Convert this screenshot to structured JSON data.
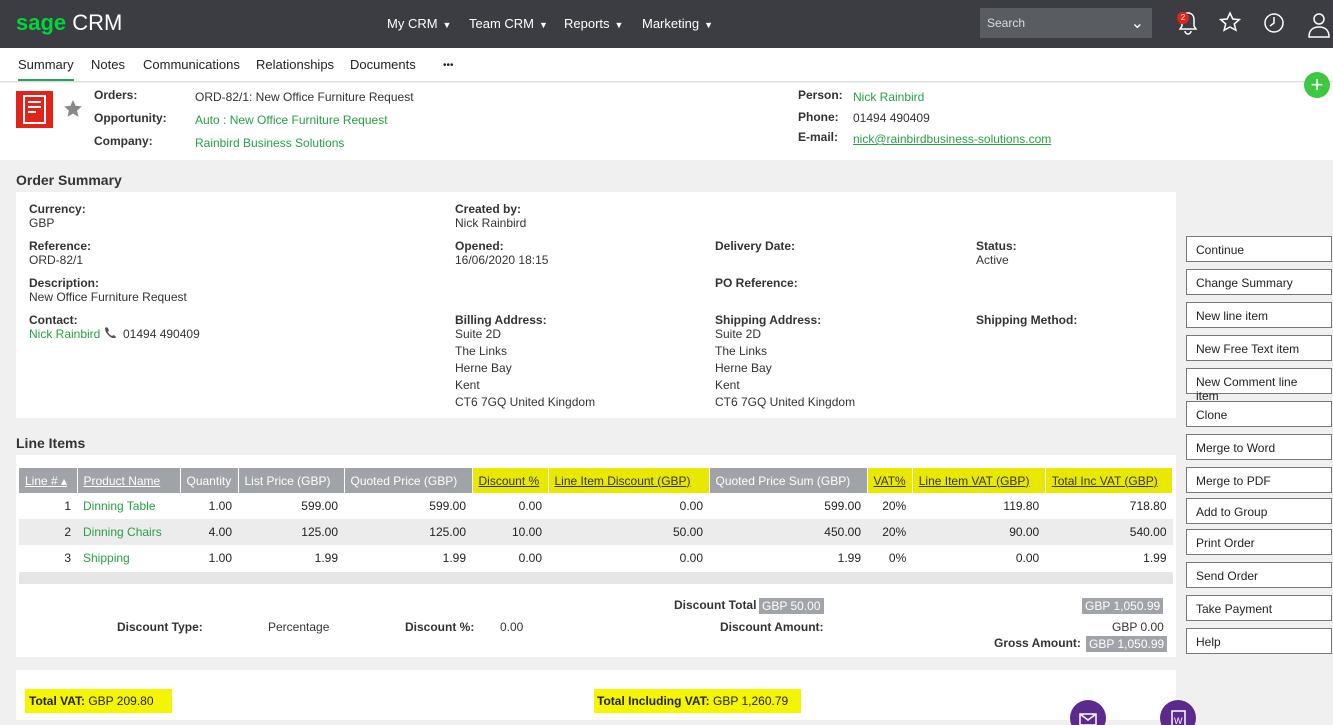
{
  "app": {
    "logo_brand": "sage",
    "logo_product": "CRM",
    "search_placeholder": "Search",
    "notification_count": "2"
  },
  "nav": [
    "My CRM",
    "Team CRM",
    "Reports",
    "Marketing"
  ],
  "tabs": [
    "Summary",
    "Notes",
    "Communications",
    "Relationships",
    "Documents",
    "•••"
  ],
  "header": {
    "orders_label": "Orders:",
    "orders_value": "ORD-82/1: New Office Furniture Request",
    "opportunity_label": "Opportunity:",
    "opportunity_value": "Auto : New Office Furniture Request",
    "company_label": "Company:",
    "company_value": "Rainbird Business Solutions",
    "person_label": "Person:",
    "person_value": "Nick Rainbird",
    "phone_label": "Phone:",
    "phone_value": "01494 490409",
    "email_label": "E-mail:",
    "email_value": "nick@rainbirdbusiness-solutions.com"
  },
  "order_summary": {
    "title": "Order Summary",
    "currency_label": "Currency:",
    "currency": "GBP",
    "created_by_label": "Created by:",
    "created_by": "Nick Rainbird",
    "reference_label": "Reference:",
    "reference": "ORD-82/1",
    "opened_label": "Opened:",
    "opened": "16/06/2020 18:15",
    "delivery_label": "Delivery Date:",
    "status_label": "Status:",
    "status": "Active",
    "description_label": "Description:",
    "description": "New Office Furniture Request",
    "po_label": "PO Reference:",
    "contact_label": "Contact:",
    "contact_name": "Nick Rainbird",
    "contact_phone": "01494 490409",
    "billing_label": "Billing Address:",
    "billing": [
      "Suite 2D",
      "The Links",
      "Herne Bay",
      "Kent",
      "CT6 7GQ United Kingdom"
    ],
    "shipping_label": "Shipping Address:",
    "shipping": [
      "Suite 2D",
      "The Links",
      "Herne Bay",
      "Kent",
      "CT6 7GQ United Kingdom"
    ],
    "shipping_method_label": "Shipping Method:"
  },
  "line_items": {
    "title": "Line Items",
    "columns": [
      "Line #",
      "Product Name",
      "Quantity",
      "List Price (GBP)",
      "Quoted Price (GBP)",
      "Discount %",
      "Line Item Discount (GBP)",
      "Quoted Price Sum (GBP)",
      "VAT%",
      "Line Item VAT (GBP)",
      "Total Inc VAT (GBP)"
    ],
    "rows": [
      [
        "1",
        "Dinning Table",
        "1.00",
        "599.00",
        "599.00",
        "0.00",
        "0.00",
        "599.00",
        "20%",
        "119.80",
        "718.80"
      ],
      [
        "2",
        "Dinning Chairs",
        "4.00",
        "125.00",
        "125.00",
        "10.00",
        "50.00",
        "450.00",
        "20%",
        "90.00",
        "540.00"
      ],
      [
        "3",
        "Shipping",
        "1.00",
        "1.99",
        "1.99",
        "0.00",
        "0.00",
        "1.99",
        "0%",
        "0.00",
        "1.99"
      ]
    ]
  },
  "totals": {
    "discount_total_label": "Discount Total",
    "discount_total": "GBP 50.00",
    "subtotal": "GBP 1,050.99",
    "discount_type_label": "Discount Type:",
    "discount_type": "Percentage",
    "discount_pct_label": "Discount %:",
    "discount_pct": "0.00",
    "discount_amount_label": "Discount Amount:",
    "discount_amount": "GBP 0.00",
    "gross_label": "Gross Amount:",
    "gross": "GBP 1,050.99",
    "total_vat_label": "Total VAT:",
    "total_vat": "GBP 209.80",
    "total_inc_label": "Total Including VAT:",
    "total_inc": "GBP 1,260.79"
  },
  "actions": [
    "Continue",
    "Change Summary",
    "New line item",
    "New Free Text item",
    "New Comment line item",
    "Clone",
    "Merge to Word",
    "Merge to PDF",
    "Add to Group",
    "Print Order",
    "Send Order",
    "Take Payment",
    "Help"
  ]
}
